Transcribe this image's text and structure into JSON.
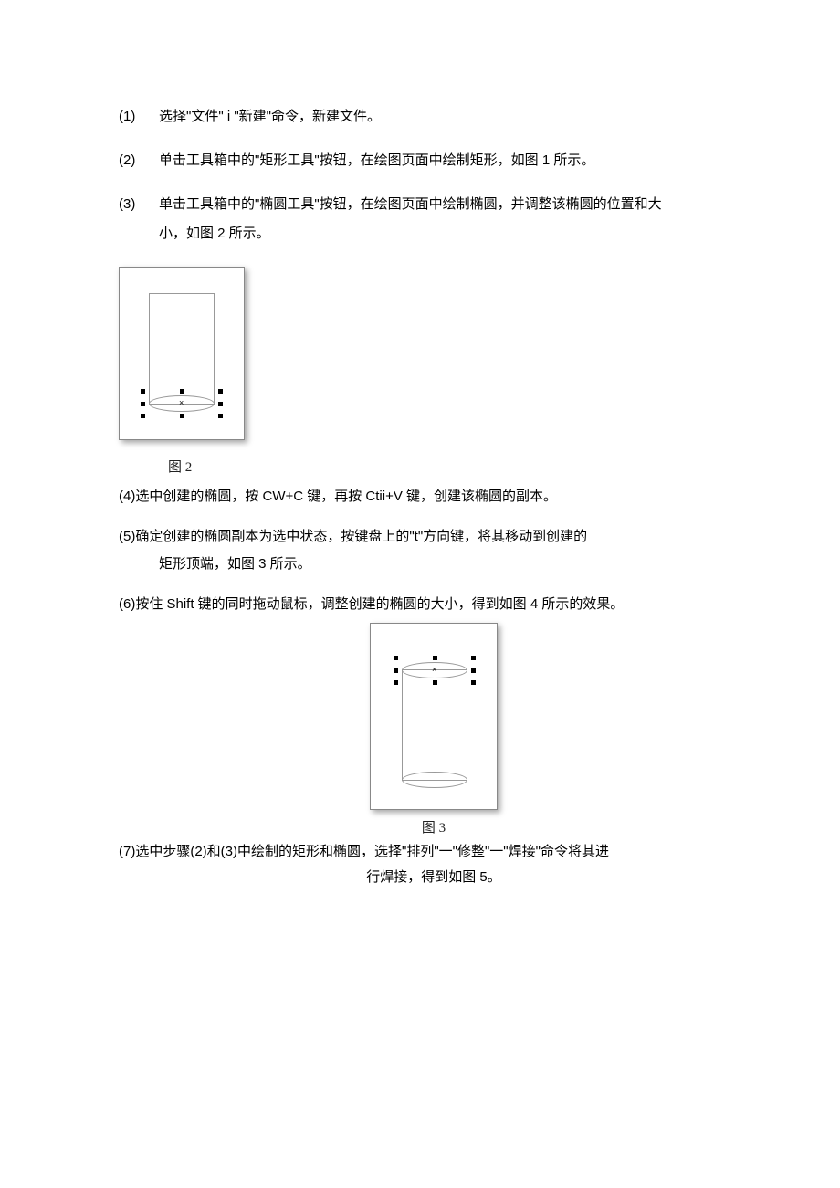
{
  "steps": {
    "s1": {
      "num": "(1)",
      "text": "选择\"文件\" i \"新建\"命令，新建文件。"
    },
    "s2": {
      "num": "(2)",
      "text": "单击工具箱中的\"矩形工具\"按钮，在绘图页面中绘制矩形，如图 1 所示。"
    },
    "s3": {
      "num": "(3)",
      "text1": "单击工具箱中的\"椭圆工具\"按钮，在绘图页面中绘制椭圆，并调整该椭圆的位置和大",
      "text2": "小，如图 2 所示。"
    },
    "s4": {
      "text": "(4)选中创建的椭圆，按 CW+C 键，再按 Ctii+V 键，创建该椭圆的副本。"
    },
    "s5": {
      "text1": "(5)确定创建的椭圆副本为选中状态，按键盘上的\"t\"方向键，将其移动到创建的",
      "text2": "矩形顶端，如图 3 所示。"
    },
    "s6": {
      "text": "(6)按住 Shift 键的同时拖动鼠标，调整创建的椭圆的大小，得到如图 4 所示的效果。"
    },
    "s7": {
      "text1": "(7)选中步骤(2)和(3)中绘制的矩形和椭圆，选择\"排列\"一\"修整\"一\"焊接\"命令将其进",
      "text2": "行焊接，得到如图 5。"
    }
  },
  "captions": {
    "fig2": "图 2",
    "fig3": "图 3"
  }
}
